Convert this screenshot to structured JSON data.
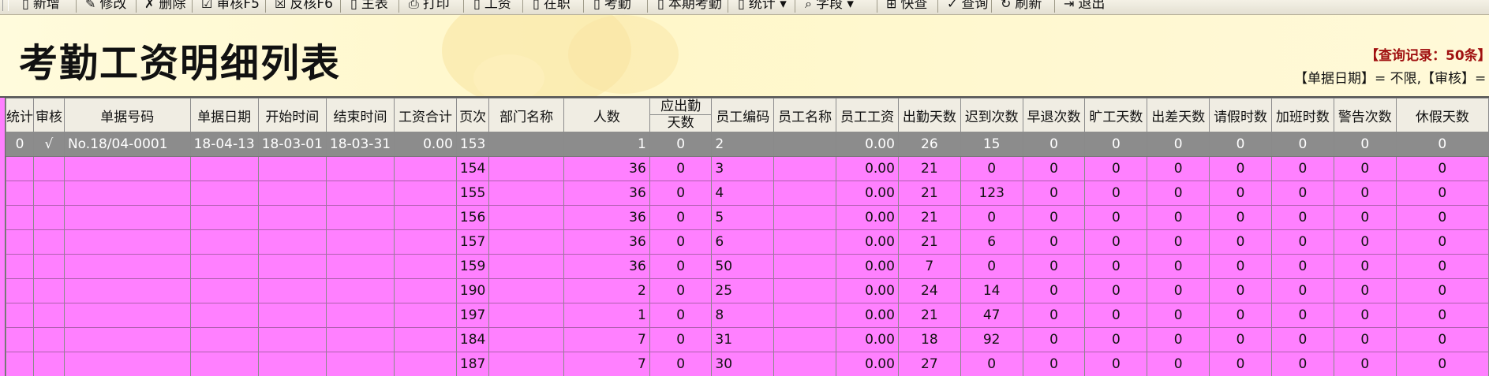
{
  "toolbar": {
    "buttons": [
      {
        "label": "新增",
        "icon": "document-icon"
      },
      {
        "label": "修改",
        "icon": "edit-icon"
      },
      {
        "label": "删除",
        "icon": "delete-icon"
      },
      {
        "label": "审核F5",
        "icon": "audit-icon"
      },
      {
        "label": "反核F6",
        "icon": "unaudit-icon"
      },
      {
        "label": "主表",
        "icon": "document-icon"
      },
      {
        "label": "打印",
        "icon": "printer-icon"
      },
      {
        "label": "工资",
        "icon": "document-icon"
      },
      {
        "label": "在职",
        "icon": "document-icon"
      },
      {
        "label": "考勤",
        "icon": "document-icon"
      },
      {
        "label": "本期考勤",
        "icon": "document-icon"
      },
      {
        "label": "统计",
        "icon": "document-icon"
      },
      {
        "label": "字段",
        "icon": "search-icon"
      },
      {
        "label": "快查",
        "icon": "quick-search-icon"
      },
      {
        "label": "查询",
        "icon": "query-icon"
      },
      {
        "label": "刷新",
        "icon": "refresh-icon"
      },
      {
        "label": "退出",
        "icon": "exit-icon"
      }
    ]
  },
  "header": {
    "title": "考勤工资明细列表",
    "query_count": "【查询记录：50条】",
    "query_conditions": "【单据日期】= 不限,【审核】= 全部"
  },
  "table": {
    "columns": [
      "统计",
      "审核",
      "单据号码",
      "单据日期",
      "开始时间",
      "结束时间",
      "工资合计",
      "页次",
      "部门名称",
      "人数",
      "应出勤天数",
      "员工编码",
      "员工名称",
      "员工工资",
      "出勤天数",
      "迟到次数",
      "早退次数",
      "旷工天数",
      "出差天数",
      "请假时数",
      "加班时数",
      "警告次数",
      "休假天数"
    ],
    "split_header": {
      "top": "应出勤",
      "bottom": "天数"
    },
    "rows": [
      [
        "0",
        "√",
        "No.18/04-0001",
        "18-04-13",
        "18-03-01",
        "18-03-31",
        "0.00",
        "153",
        "",
        "1",
        "0",
        "2",
        "",
        "0.00",
        "26",
        "15",
        "0",
        "0",
        "0",
        "0",
        "0",
        "0",
        "0"
      ],
      [
        "",
        "",
        "",
        "",
        "",
        "",
        "",
        "154",
        "",
        "36",
        "0",
        "3",
        "",
        "0.00",
        "21",
        "0",
        "0",
        "0",
        "0",
        "0",
        "0",
        "0",
        "0"
      ],
      [
        "",
        "",
        "",
        "",
        "",
        "",
        "",
        "155",
        "",
        "36",
        "0",
        "4",
        "",
        "0.00",
        "21",
        "123",
        "0",
        "0",
        "0",
        "0",
        "0",
        "0",
        "0"
      ],
      [
        "",
        "",
        "",
        "",
        "",
        "",
        "",
        "156",
        "",
        "36",
        "0",
        "5",
        "",
        "0.00",
        "21",
        "0",
        "0",
        "0",
        "0",
        "0",
        "0",
        "0",
        "0"
      ],
      [
        "",
        "",
        "",
        "",
        "",
        "",
        "",
        "157",
        "",
        "36",
        "0",
        "6",
        "",
        "0.00",
        "21",
        "6",
        "0",
        "0",
        "0",
        "0",
        "0",
        "0",
        "0"
      ],
      [
        "",
        "",
        "",
        "",
        "",
        "",
        "",
        "159",
        "",
        "36",
        "0",
        "50",
        "",
        "0.00",
        "7",
        "0",
        "0",
        "0",
        "0",
        "0",
        "0",
        "0",
        "0"
      ],
      [
        "",
        "",
        "",
        "",
        "",
        "",
        "",
        "190",
        "",
        "2",
        "0",
        "25",
        "",
        "0.00",
        "24",
        "14",
        "0",
        "0",
        "0",
        "0",
        "0",
        "0",
        "0"
      ],
      [
        "",
        "",
        "",
        "",
        "",
        "",
        "",
        "197",
        "",
        "1",
        "0",
        "8",
        "",
        "0.00",
        "21",
        "47",
        "0",
        "0",
        "0",
        "0",
        "0",
        "0",
        "0"
      ],
      [
        "",
        "",
        "",
        "",
        "",
        "",
        "",
        "184",
        "",
        "7",
        "0",
        "31",
        "",
        "0.00",
        "18",
        "92",
        "0",
        "0",
        "0",
        "0",
        "0",
        "0",
        "0"
      ],
      [
        "",
        "",
        "",
        "",
        "",
        "",
        "",
        "187",
        "",
        "7",
        "0",
        "30",
        "",
        "0.00",
        "27",
        "0",
        "0",
        "0",
        "0",
        "0",
        "0",
        "0",
        "0"
      ]
    ],
    "selected_row": 0
  },
  "colors": {
    "row_bg": "#ff80ff",
    "selected_row_bg": "#8c8c8c",
    "header_bg": "#fffbdc",
    "count_text": "#a01010"
  }
}
